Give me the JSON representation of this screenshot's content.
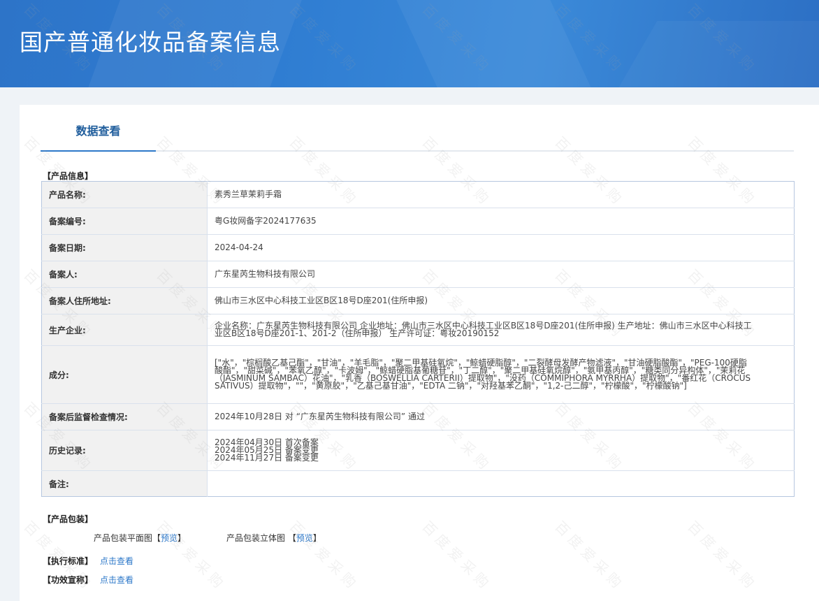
{
  "header": {
    "title": "国产普通化妆品备案信息"
  },
  "tab": {
    "label": "数据查看"
  },
  "sections": {
    "product_info": "【产品信息】",
    "packaging": "【产品包装】",
    "standard": "【执行标准】",
    "claims": "【功效宣称】"
  },
  "product_info": [
    {
      "label": "产品名称:",
      "value": "素秀兰草茉莉手霜"
    },
    {
      "label": "备案编号:",
      "value": "粤G妆网备字2024177635"
    },
    {
      "label": "备案日期:",
      "value": "2024-04-24"
    },
    {
      "label": "备案人:",
      "value": "广东星芮生物科技有限公司"
    },
    {
      "label": "备案人住所地址:",
      "value": "佛山市三水区中心科技工业区B区18号D座201(住所申报)"
    },
    {
      "label": "生产企业:",
      "value": "企业名称：广东星芮生物科技有限公司 企业地址：佛山市三水区中心科技工业区B区18号D座201(住所申报) 生产地址：佛山市三水区中心科技工业区B区18号D座201-1、201-2（住所申报） 生产许可证：粤妆20190152"
    },
    {
      "label": "成分:",
      "value": "[\"水\"，\"棕榈酸乙基己酯\"，\"甘油\"，\"羊毛脂\"，\"聚二甲基硅氧烷\"，\"鲸蜡硬脂醇\"，\"二裂酵母发酵产物滤液\"，\"甘油硬脂酸酯\"，\"PEG-100硬脂酸酯\"，\"甜菜碱\"，\"苯氧乙醇\"，\"卡波姆\"，\"鲸蜡硬脂基葡糖苷\"，\"丁二醇\"，\"聚二甲基硅氧烷醇\"，\"氨甲基丙醇\"，\"糖类同分异构体\"，\"茉莉花（JASMINUM SAMBAC）花油\"，\"乳香（BOSWELLIA CARTERII）提取物\"，\"没药（COMMIPHORA MYRRHA）提取物\"，\"番红花（CROCUS SATIVUS）提取物\"，\"\"，\"黄原胶\"，\"乙基己基甘油\"，\"EDTA 二钠\"，\"对羟基苯乙酮\"，\"1,2-己二醇\"，\"柠檬酸\"，\"柠檬酸钠\"]"
    },
    {
      "label": "备案后监督检查情况:",
      "value": "2024年10月28日 对 “广东星芮生物科技有限公司” 通过"
    },
    {
      "label": "历史记录:",
      "lines": [
        "2024年04月30日 首次备案",
        "2024年05月25日 备案变更",
        "2024年11月27日 备案变更"
      ]
    },
    {
      "label": "备注:",
      "value": ""
    }
  ],
  "packaging": {
    "flat_label": "产品包装平面图",
    "stereo_label": "产品包装立体图",
    "preview": "预览",
    "bracket_open": "【",
    "bracket_close": "】"
  },
  "links": {
    "view": "点击查看"
  },
  "watermark": "百度爱采购"
}
